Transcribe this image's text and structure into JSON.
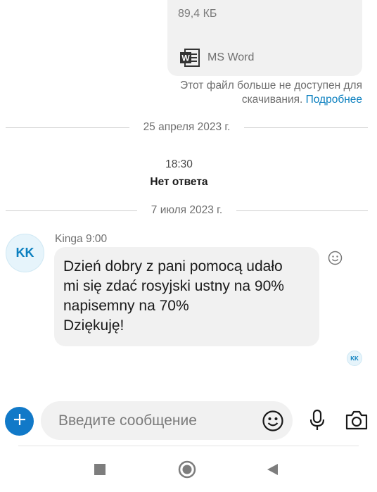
{
  "file": {
    "size": "89,4 КБ",
    "type_label": "MS Word",
    "unavailable_text": "Этот файл больше не доступен для скачивания.",
    "more_link": "Подробнее"
  },
  "separators": [
    {
      "date": "25 апреля 2023 г."
    },
    {
      "date": "7 июля 2023 г."
    }
  ],
  "call": {
    "time": "18:30",
    "status": "Нет ответа"
  },
  "message": {
    "avatar_initials": "KK",
    "sender": "Kinga 9:00",
    "text": "Dzień dobry z pani pomocą udało\nmi się zdać rosyjski ustny na 90%\nnapisemny na 70%\nDziękuję!",
    "read_initials": "KK"
  },
  "composer": {
    "placeholder": "Введите сообщение"
  },
  "colors": {
    "accent": "#0a7fbf",
    "add_button": "#1179c8",
    "bubble": "#f1f1f1"
  },
  "icons": [
    "word-icon",
    "emoji-reaction-icon",
    "plus-icon",
    "emoji-icon",
    "microphone-icon",
    "camera-icon",
    "recent-apps-icon",
    "home-icon",
    "back-icon"
  ]
}
